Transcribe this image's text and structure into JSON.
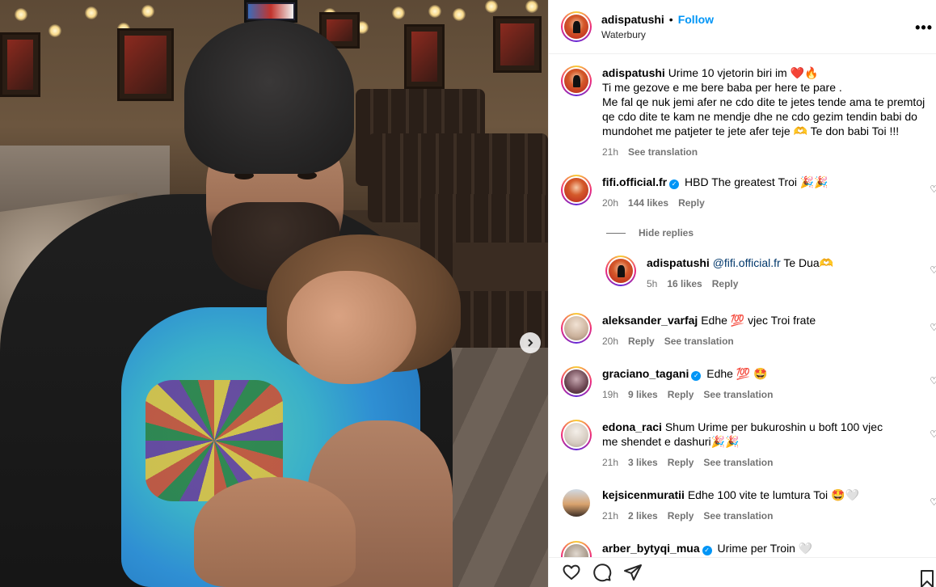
{
  "post": {
    "username": "adispatushi",
    "follow_label": "Follow",
    "location": "Waterbury",
    "more_label": "•••",
    "separator": "•"
  },
  "caption": {
    "username": "adispatushi",
    "lines": [
      "Urime 10 vjetorin biri im ❤️🔥",
      "Ti me gezove e me bere baba per here te pare .",
      "Me fal qe nuk jemi afer ne cdo dite te jetes tende ama te premtoj qe cdo dite te kam ne mendje dhe ne cdo gezim tendin babi do mundohet me patjeter te jete afer teje 🫶 Te don babi Toi !!!"
    ],
    "time": "21h",
    "translation": "See translation"
  },
  "comments": [
    {
      "username": "fifi.official.fr",
      "verified": true,
      "text": "HBD The greatest Troi 🎉🎉",
      "time": "20h",
      "likes": "144 likes",
      "reply": "Reply"
    },
    {
      "username": "adispatushi",
      "mention": "@fifi.official.fr",
      "text": "Te Dua🫶",
      "time": "5h",
      "likes": "16 likes",
      "reply": "Reply"
    },
    {
      "username": "aleksander_varfaj",
      "text": "Edhe 💯 vjec Troi frate",
      "time": "20h",
      "reply": "Reply",
      "translation": "See translation"
    },
    {
      "username": "graciano_tagani",
      "verified": true,
      "text": "Edhe 💯 🤩",
      "time": "19h",
      "likes": "9 likes",
      "reply": "Reply",
      "translation": "See translation"
    },
    {
      "username": "edona_raci",
      "text": "Shum Urime per bukuroshin u boft 100 vjec me shendet e dashuri🎉🎉",
      "time": "21h",
      "likes": "3 likes",
      "reply": "Reply",
      "translation": "See translation"
    },
    {
      "username": "kejsicenmuratii",
      "text": "Edhe 100 vite te lumtura Toi 🤩🤍",
      "time": "21h",
      "likes": "2 likes",
      "reply": "Reply",
      "translation": "See translation"
    },
    {
      "username": "arber_bytyqi_mua",
      "verified": true,
      "text": "Urime per Troin 🤍"
    }
  ],
  "hide_replies": "Hide replies",
  "icons": {
    "like": "heart-icon",
    "comment": "comment-icon",
    "share": "share-icon",
    "save": "bookmark-icon",
    "next": "chevron-right-icon"
  },
  "colors": {
    "link": "#0095f6",
    "muted": "#737373",
    "mention": "#00376b"
  }
}
